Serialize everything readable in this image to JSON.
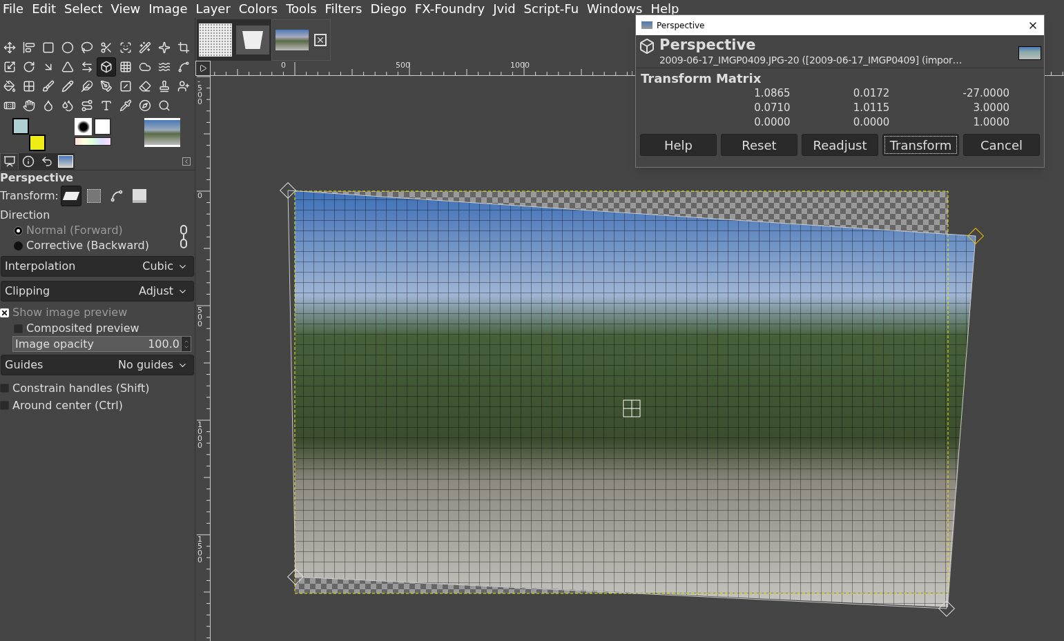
{
  "menu": [
    "File",
    "Edit",
    "Select",
    "View",
    "Image",
    "Layer",
    "Colors",
    "Tools",
    "Filters",
    "Diego",
    "FX-Foundry",
    "Jvid",
    "Script-Fu",
    "Windows",
    "Help"
  ],
  "tools": [
    {
      "selected": false
    },
    {
      "selected": false
    },
    {
      "selected": false
    },
    {
      "selected": false
    },
    {
      "selected": false
    },
    {
      "selected": false
    },
    {
      "selected": false
    },
    {
      "selected": false
    },
    {
      "selected": false
    },
    {
      "selected": false
    },
    {
      "selected": false
    },
    {
      "selected": false
    },
    {
      "selected": false
    },
    {
      "selected": false
    },
    {
      "selected": false
    },
    {
      "selected": true
    },
    {
      "selected": false
    },
    {
      "selected": false
    },
    {
      "selected": false
    },
    {
      "selected": false
    },
    {
      "selected": false
    },
    {
      "selected": false
    },
    {
      "selected": false
    },
    {
      "selected": false
    },
    {
      "selected": false
    },
    {
      "selected": false
    },
    {
      "selected": false
    },
    {
      "selected": false
    },
    {
      "selected": false
    },
    {
      "selected": false
    },
    {
      "selected": false
    },
    {
      "selected": false
    },
    {
      "selected": false
    },
    {
      "selected": false
    },
    {
      "selected": false
    },
    {
      "selected": false
    },
    {
      "selected": false
    },
    {
      "selected": false
    },
    {
      "selected": false
    }
  ],
  "colors": [
    {
      "kind": "foreground",
      "color": "#aed0d2"
    },
    {
      "kind": "background",
      "color": "#eeee14"
    }
  ],
  "dock_tabs": [
    {
      "selected": true
    },
    {
      "selected": false
    },
    {
      "selected": false
    },
    {
      "selected": false
    }
  ],
  "tool_options": {
    "title": "Perspective",
    "transform_label": "Transform:",
    "transform_modes": [
      {
        "selected": true
      },
      {
        "selected": false
      },
      {
        "selected": false
      },
      {
        "selected": false
      }
    ],
    "direction_label": "Direction",
    "directions": [
      {
        "label": "Normal (Forward)",
        "selected": true
      },
      {
        "label": "Corrective (Backward)",
        "selected": false
      }
    ],
    "interpolation": {
      "label": "Interpolation",
      "value": "Cubic"
    },
    "clipping": {
      "label": "Clipping",
      "value": "Adjust"
    },
    "show_preview": {
      "label": "Show image preview",
      "checked": true
    },
    "composited_preview": {
      "label": "Composited preview",
      "checked": false
    },
    "opacity": {
      "label": "Image opacity",
      "value": "100.0",
      "level": 1
    },
    "guides": {
      "label": "Guides",
      "value": "No guides"
    },
    "options": [
      {
        "label": "Constrain handles (Shift)",
        "checked": false
      },
      {
        "label": "Around center (Ctrl)",
        "checked": false
      }
    ]
  },
  "image_tabs": [
    {
      "kind": "pattern",
      "selected": false
    },
    {
      "kind": "brush",
      "selected": false
    },
    {
      "kind": "image",
      "selected": true
    }
  ],
  "ruler_h": [
    "0",
    "500",
    "1000"
  ],
  "ruler_v": [
    "-500",
    "0",
    "500",
    "1000",
    "1500"
  ],
  "dialog": {
    "title": "Perspective",
    "heading": "Perspective",
    "subtitle": "2009-06-17_IMGP0409.JPG-20 ([2009-06-17_IMGP0409] (impor…",
    "matrix_title": "Transform Matrix",
    "matrix": [
      [
        "1.0865",
        "0.0172",
        "-27.0000"
      ],
      [
        "0.0710",
        "1.0115",
        "3.0000"
      ],
      [
        "0.0000",
        "0.0000",
        "1.0000"
      ]
    ],
    "buttons": [
      {
        "label": "Help",
        "focused": false
      },
      {
        "label": "Reset",
        "focused": false
      },
      {
        "label": "Readjust",
        "focused": false
      },
      {
        "label": "Transform",
        "focused": true
      },
      {
        "label": "Cancel",
        "focused": false
      }
    ]
  }
}
